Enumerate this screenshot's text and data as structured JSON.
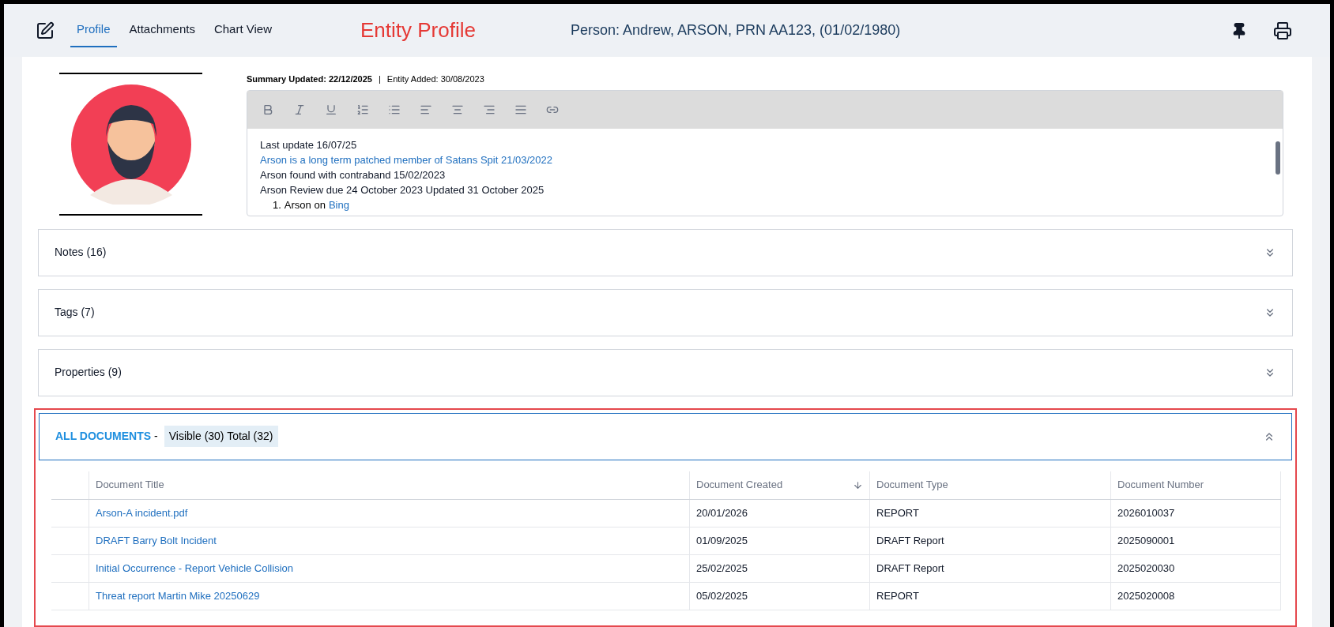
{
  "header": {
    "tabs": [
      {
        "label": "Profile",
        "selected": true
      },
      {
        "label": "Attachments",
        "selected": false
      },
      {
        "label": "Chart View",
        "selected": false
      }
    ],
    "annotation_title": "Entity Profile",
    "person": "Person: Andrew, ARSON, PRN AA123, (01/02/1980)"
  },
  "summary": {
    "updated_label": "Summary Updated: 22/12/2025",
    "separator": "|",
    "added": "Entity Added: 30/08/2023",
    "lines": [
      {
        "kind": "plain",
        "text": "Last update 16/07/25"
      },
      {
        "kind": "link",
        "text": "Arson is a long term patched member of Satans Spit 21/03/2022"
      },
      {
        "kind": "plain",
        "text": "Arson found with contraband 15/02/2023"
      },
      {
        "kind": "plain",
        "text": "Arson Review due 24 October 2023 Updated 31 October 2025"
      },
      {
        "kind": "list",
        "number": "1.",
        "text": "Arson on",
        "link": "Bing"
      }
    ]
  },
  "sections": [
    {
      "title": "Notes (16)",
      "expanded": false
    },
    {
      "title": "Tags (7)",
      "expanded": false
    },
    {
      "title": "Properties (9)",
      "expanded": false
    }
  ],
  "documents": {
    "title": "ALL DOCUMENTS",
    "dash": "-",
    "counts": "Visible (30) Total (32)",
    "expanded": true,
    "columns": [
      {
        "label": "Document Title",
        "sorted": false
      },
      {
        "label": "Document Created",
        "sorted": true
      },
      {
        "label": "Document Type",
        "sorted": false
      },
      {
        "label": "Document Number",
        "sorted": false
      }
    ],
    "rows": [
      [
        "Arson-A incident.pdf",
        "20/01/2026",
        "REPORT",
        "2026010037"
      ],
      [
        "DRAFT Barry Bolt Incident",
        "01/09/2025",
        "DRAFT Report",
        "2025090001"
      ],
      [
        "Initial Occurrence - Report Vehicle Collision",
        "25/02/2025",
        "DRAFT Report",
        "2025020030"
      ],
      [
        "Threat report Martin Mike 20250629",
        "05/02/2025",
        "REPORT",
        "2025020008"
      ]
    ]
  }
}
